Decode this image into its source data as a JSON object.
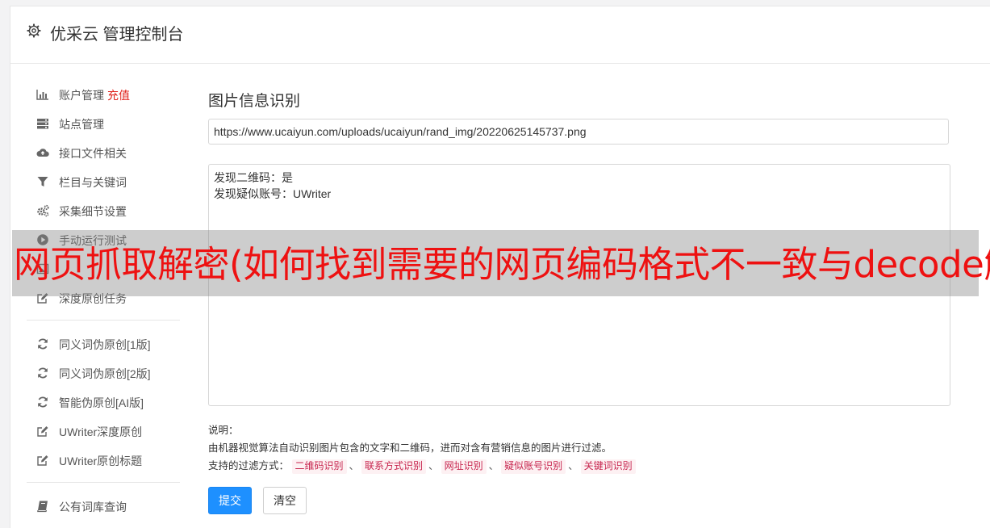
{
  "header": {
    "title": "优采云 管理控制台"
  },
  "sidebar": {
    "items": [
      {
        "label": "账户管理",
        "extra": "充值",
        "icon": "bar-chart-icon"
      },
      {
        "label": "站点管理",
        "icon": "server-icon"
      },
      {
        "label": "接口文件相关",
        "icon": "cloud-upload-icon"
      },
      {
        "label": "栏目与关键词",
        "icon": "filter-icon"
      },
      {
        "label": "采集细节设置",
        "icon": "gears-icon"
      },
      {
        "label": "手动运行测试",
        "icon": "play-circle-icon"
      },
      {
        "label": "",
        "icon": "image-icon"
      },
      {
        "label": "深度原创任务",
        "icon": "edit-icon"
      },
      {
        "label": "同义词伪原创[1版]",
        "icon": "refresh-icon"
      },
      {
        "label": "同义词伪原创[2版]",
        "icon": "refresh-icon"
      },
      {
        "label": "智能伪原创[AI版]",
        "icon": "refresh-icon"
      },
      {
        "label": "UWriter深度原创",
        "icon": "edit-icon"
      },
      {
        "label": "UWriter原创标题",
        "icon": "edit-icon"
      },
      {
        "label": "公有词库查询",
        "icon": "book-icon"
      }
    ]
  },
  "main": {
    "section_title": "图片信息识别",
    "url_value": "https://www.ucaiyun.com/uploads/ucaiyun/rand_img/20220625145737.png",
    "result_lines": [
      "发现二维码：是",
      "发现疑似账号：UWriter"
    ],
    "notes": {
      "label": "说明：",
      "description": "由机器视觉算法自动识别图片包含的文字和二维码，进而对含有营销信息的图片进行过滤。",
      "filter_label": "支持的过滤方式：",
      "filters": [
        "二维码识别",
        "联系方式识别",
        "网址识别",
        "疑似账号识别",
        "关键词识别"
      ],
      "separator": "、"
    },
    "submit_label": "提交",
    "clear_label": "清空"
  },
  "overlay": {
    "text": "网页抓取解密(如何找到需要的网页编码格式不一致与decode解"
  },
  "colors": {
    "primary": "#1e90ff",
    "accent_red": "#e0231c",
    "overlay_text": "#ee1111"
  }
}
